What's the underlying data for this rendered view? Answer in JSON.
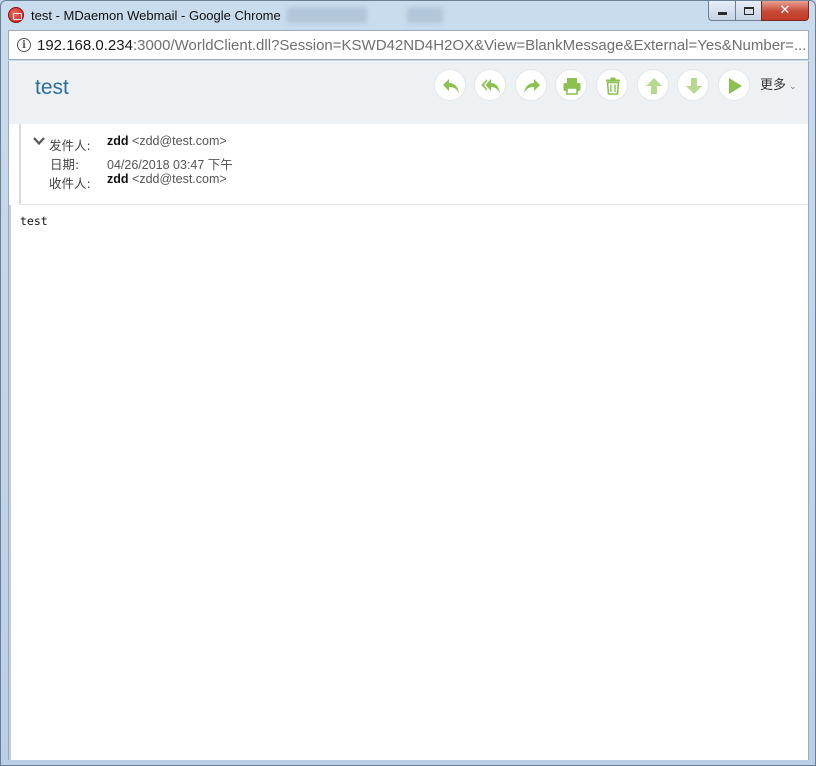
{
  "window": {
    "title": "test - MDaemon Webmail - Google Chrome",
    "blurred_tabs": [
      "",
      ""
    ]
  },
  "address": {
    "host": "192.168.0.234",
    "rest": ":3000/WorldClient.dll?Session=KSWD42ND4H2OX&View=BlankMessage&External=Yes&Number=..."
  },
  "toolbar": {
    "subject": "test",
    "more_label": "更多",
    "buttons": [
      {
        "name": "reply-button",
        "icon": "reply-icon"
      },
      {
        "name": "reply-all-button",
        "icon": "reply-all-icon"
      },
      {
        "name": "forward-button",
        "icon": "forward-icon"
      },
      {
        "name": "print-button",
        "icon": "print-icon"
      },
      {
        "name": "delete-button",
        "icon": "trash-icon"
      },
      {
        "name": "previous-message-button",
        "icon": "arrow-up-icon"
      },
      {
        "name": "next-message-button",
        "icon": "arrow-down-icon"
      },
      {
        "name": "play-button",
        "icon": "play-icon"
      }
    ],
    "icon_color": "#8cc152"
  },
  "headers": {
    "from_label": "发件人:",
    "from_name": "zdd",
    "from_email": "<zdd@test.com>",
    "date_label": "日期:",
    "date_value": "04/26/2018 03:47 下午",
    "to_label": "收件人:",
    "to_name": "zdd",
    "to_email": "<zdd@test.com>"
  },
  "message": {
    "body": "test"
  },
  "colors": {
    "subject": "#2b6e9e",
    "accent_green": "#8cc152",
    "close_button": "#c74a36"
  }
}
